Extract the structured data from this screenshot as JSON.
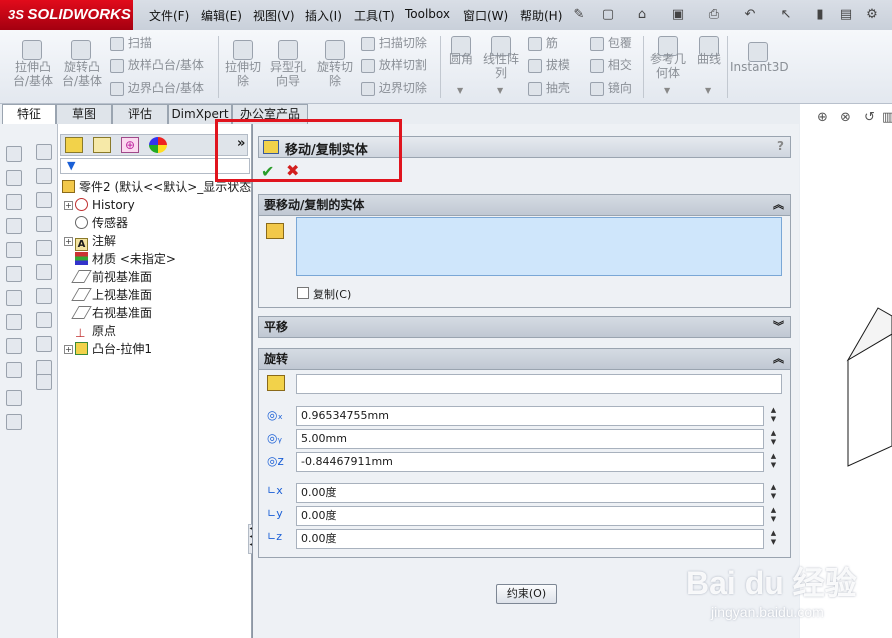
{
  "app": {
    "logo": "SOLIDWORKS",
    "logo_prefix": "3S"
  },
  "menu": [
    "文件(F)",
    "编辑(E)",
    "视图(V)",
    "插入(I)",
    "工具(T)",
    "Toolbox",
    "窗口(W)",
    "帮助(H)"
  ],
  "ribbon": {
    "extrude_boss": "拉伸凸\n台/基体",
    "revolve_boss": "旋转凸\n台/基体",
    "sweep": "扫描",
    "loft_boss": "放样凸台/基体",
    "boundary_boss": "边界凸台/基体",
    "extrude_cut": "拉伸切\n除",
    "hole_wizard": "异型孔\n向导",
    "revolve_cut": "旋转切\n除",
    "sweep_cut": "扫描切除",
    "loft_cut": "放样切割",
    "boundary_cut": "边界切除",
    "fillet": "圆角",
    "linear_pattern": "线性阵\n列",
    "rib": "筋",
    "draft": "拔模",
    "shell": "抽壳",
    "wrap": "包覆",
    "intersect": "相交",
    "mirror": "镜向",
    "ref_geometry": "参考几\n何体",
    "curves": "曲线",
    "instant3d": "Instant3D"
  },
  "tabs": [
    "特征",
    "草图",
    "评估",
    "DimXpert",
    "办公室产品"
  ],
  "tree": {
    "root": "零件2 (默认<<默认>_显示状态",
    "items": [
      "History",
      "传感器",
      "注解",
      "材质 <未指定>",
      "前视基准面",
      "上视基准面",
      "右视基准面",
      "原点",
      "凸台-拉伸1"
    ]
  },
  "panel": {
    "title": "移动/复制实体",
    "help": "?",
    "section_bodies": "要移动/复制的实体",
    "copy_label": "复制(C)",
    "copy_checked": false,
    "section_translate": "平移",
    "section_rotate": "旋转",
    "rotate_x": "0.96534755mm",
    "rotate_y": "5.00mm",
    "rotate_z": "-0.84467911mm",
    "angle_x": "0.00度",
    "angle_y": "0.00度",
    "angle_z": "0.00度",
    "constraints_button": "约束(O)"
  },
  "watermark": {
    "brand": "Bai du 经验",
    "url": "jingyan.baidu.com"
  },
  "colors": {
    "highlight": "#e0141e",
    "selection_bg": "#cfe6fb",
    "accept": "#2a9d2a",
    "cancel": "#d21f1f"
  }
}
